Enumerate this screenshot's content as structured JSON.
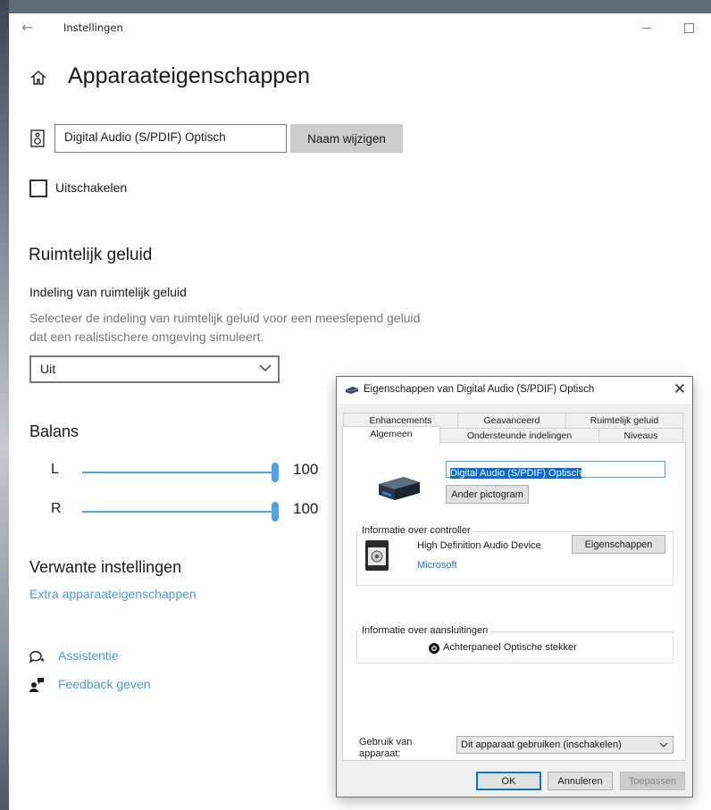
{
  "window": {
    "title": "Instellingen"
  },
  "page": {
    "title": "Apparaateigenschappen"
  },
  "device": {
    "name_value": "Digital Audio (S/PDIF) Optisch",
    "rename_label": "Naam wijzigen",
    "disable_label": "Uitschakelen"
  },
  "spatial": {
    "heading": "Ruimtelijk geluid",
    "sublabel": "Indeling van ruimtelijk geluid",
    "description": "Selecteer de indeling van ruimtelijk geluid voor een meeslepend geluid dat een realistischere omgeving simuleert.",
    "selected": "Uit"
  },
  "balance": {
    "heading": "Balans",
    "channels": [
      {
        "label": "L",
        "value": "100",
        "level": 1.0
      },
      {
        "label": "R",
        "value": "100",
        "level": 1.0
      }
    ]
  },
  "related": {
    "heading": "Verwante instellingen",
    "link": "Extra apparaateigenschappen"
  },
  "help": {
    "assist": "Assistentie",
    "feedback": "Feedback geven"
  },
  "dialog": {
    "title": "Eigenschappen van Digital Audio (S/PDIF) Optisch",
    "tabs_row1": [
      "Enhancements",
      "Geavanceerd",
      "Ruimtelijk geluid"
    ],
    "tabs_row2": [
      "Algemeen",
      "Ondersteunde indelingen",
      "Niveaus"
    ],
    "selected_tab": "Algemeen",
    "device_name": "Digital Audio (S/PDIF) Optisch",
    "change_icon": "Ander pictogram",
    "controller_group": "Informatie over controller",
    "controller_name": "High Definition Audio Device",
    "controller_vendor": "Microsoft",
    "properties_button": "Eigenschappen",
    "jack_group": "Informatie over aansluitingen",
    "jack_label": "Achterpaneel Optische stekker",
    "usage_label": "Gebruik van apparaat:",
    "usage_value": "Dit apparaat gebruiken (inschakelen)",
    "ok": "OK",
    "cancel": "Annuleren",
    "apply": "Toepassen"
  },
  "colors": {
    "accent": "#4da3f0",
    "link": "#4a9cd6",
    "selection": "#0a6ad7"
  }
}
